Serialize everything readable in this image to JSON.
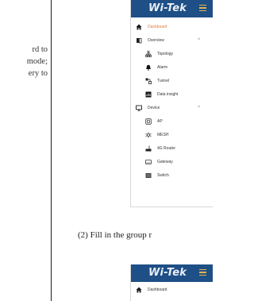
{
  "left_text": {
    "lines": [
      "rd to",
      "mode;",
      "ery to"
    ]
  },
  "caption": "(2) Fill in the group r",
  "panel_top": {
    "logo": "Wi-Tek",
    "nav": [
      {
        "label": "Dashboard",
        "icon": "home-icon",
        "level": 0,
        "active": true
      },
      {
        "label": "Overview",
        "icon": "book-icon",
        "level": 0,
        "chevron": "^"
      },
      {
        "label": "Topology",
        "icon": "topology-icon",
        "level": 1
      },
      {
        "label": "Alarm",
        "icon": "bell-icon",
        "level": 1
      },
      {
        "label": "Tunnel",
        "icon": "tunnel-icon",
        "level": 1
      },
      {
        "label": "Data insight",
        "icon": "chart-icon",
        "level": 1
      },
      {
        "label": "Device",
        "icon": "monitor-icon",
        "level": 0,
        "chevron": "^"
      },
      {
        "label": "AP",
        "icon": "ap-icon",
        "level": 1
      },
      {
        "label": "MESH",
        "icon": "mesh-icon",
        "level": 1
      },
      {
        "label": "4G Router",
        "icon": "router-icon",
        "level": 1
      },
      {
        "label": "Gateway",
        "icon": "gateway-icon",
        "level": 1
      },
      {
        "label": "Switch",
        "icon": "switch-icon",
        "level": 1
      }
    ]
  },
  "panel_bottom": {
    "logo": "Wi-Tek",
    "nav": [
      {
        "label": "Dashboard",
        "icon": "home-icon",
        "level": 0
      }
    ]
  },
  "colors": {
    "topbar": "#1e4f86",
    "accent": "#e07a3a",
    "menu_icon": "#e4b44a"
  }
}
